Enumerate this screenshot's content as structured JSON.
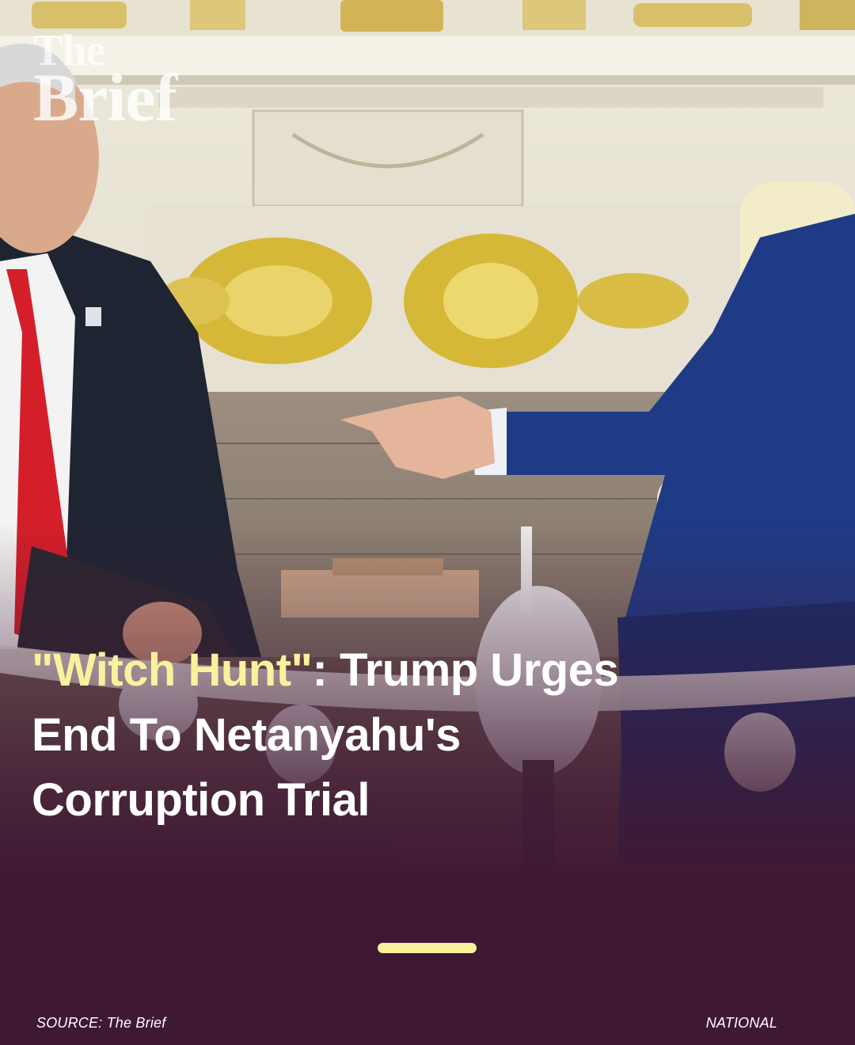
{
  "brand": {
    "line1": "The",
    "line2": "Brief"
  },
  "headline": {
    "highlight": "\"Witch Hunt\"",
    "rest_line1": ": Trump Urges",
    "line2": "End To Netanyahu's",
    "line3": "Corruption Trial"
  },
  "footer": {
    "source": "SOURCE: The Brief",
    "category": "NATIONAL"
  },
  "colors": {
    "background": "#3f1834",
    "accent": "#fbf19c",
    "text": "#ffffff"
  }
}
